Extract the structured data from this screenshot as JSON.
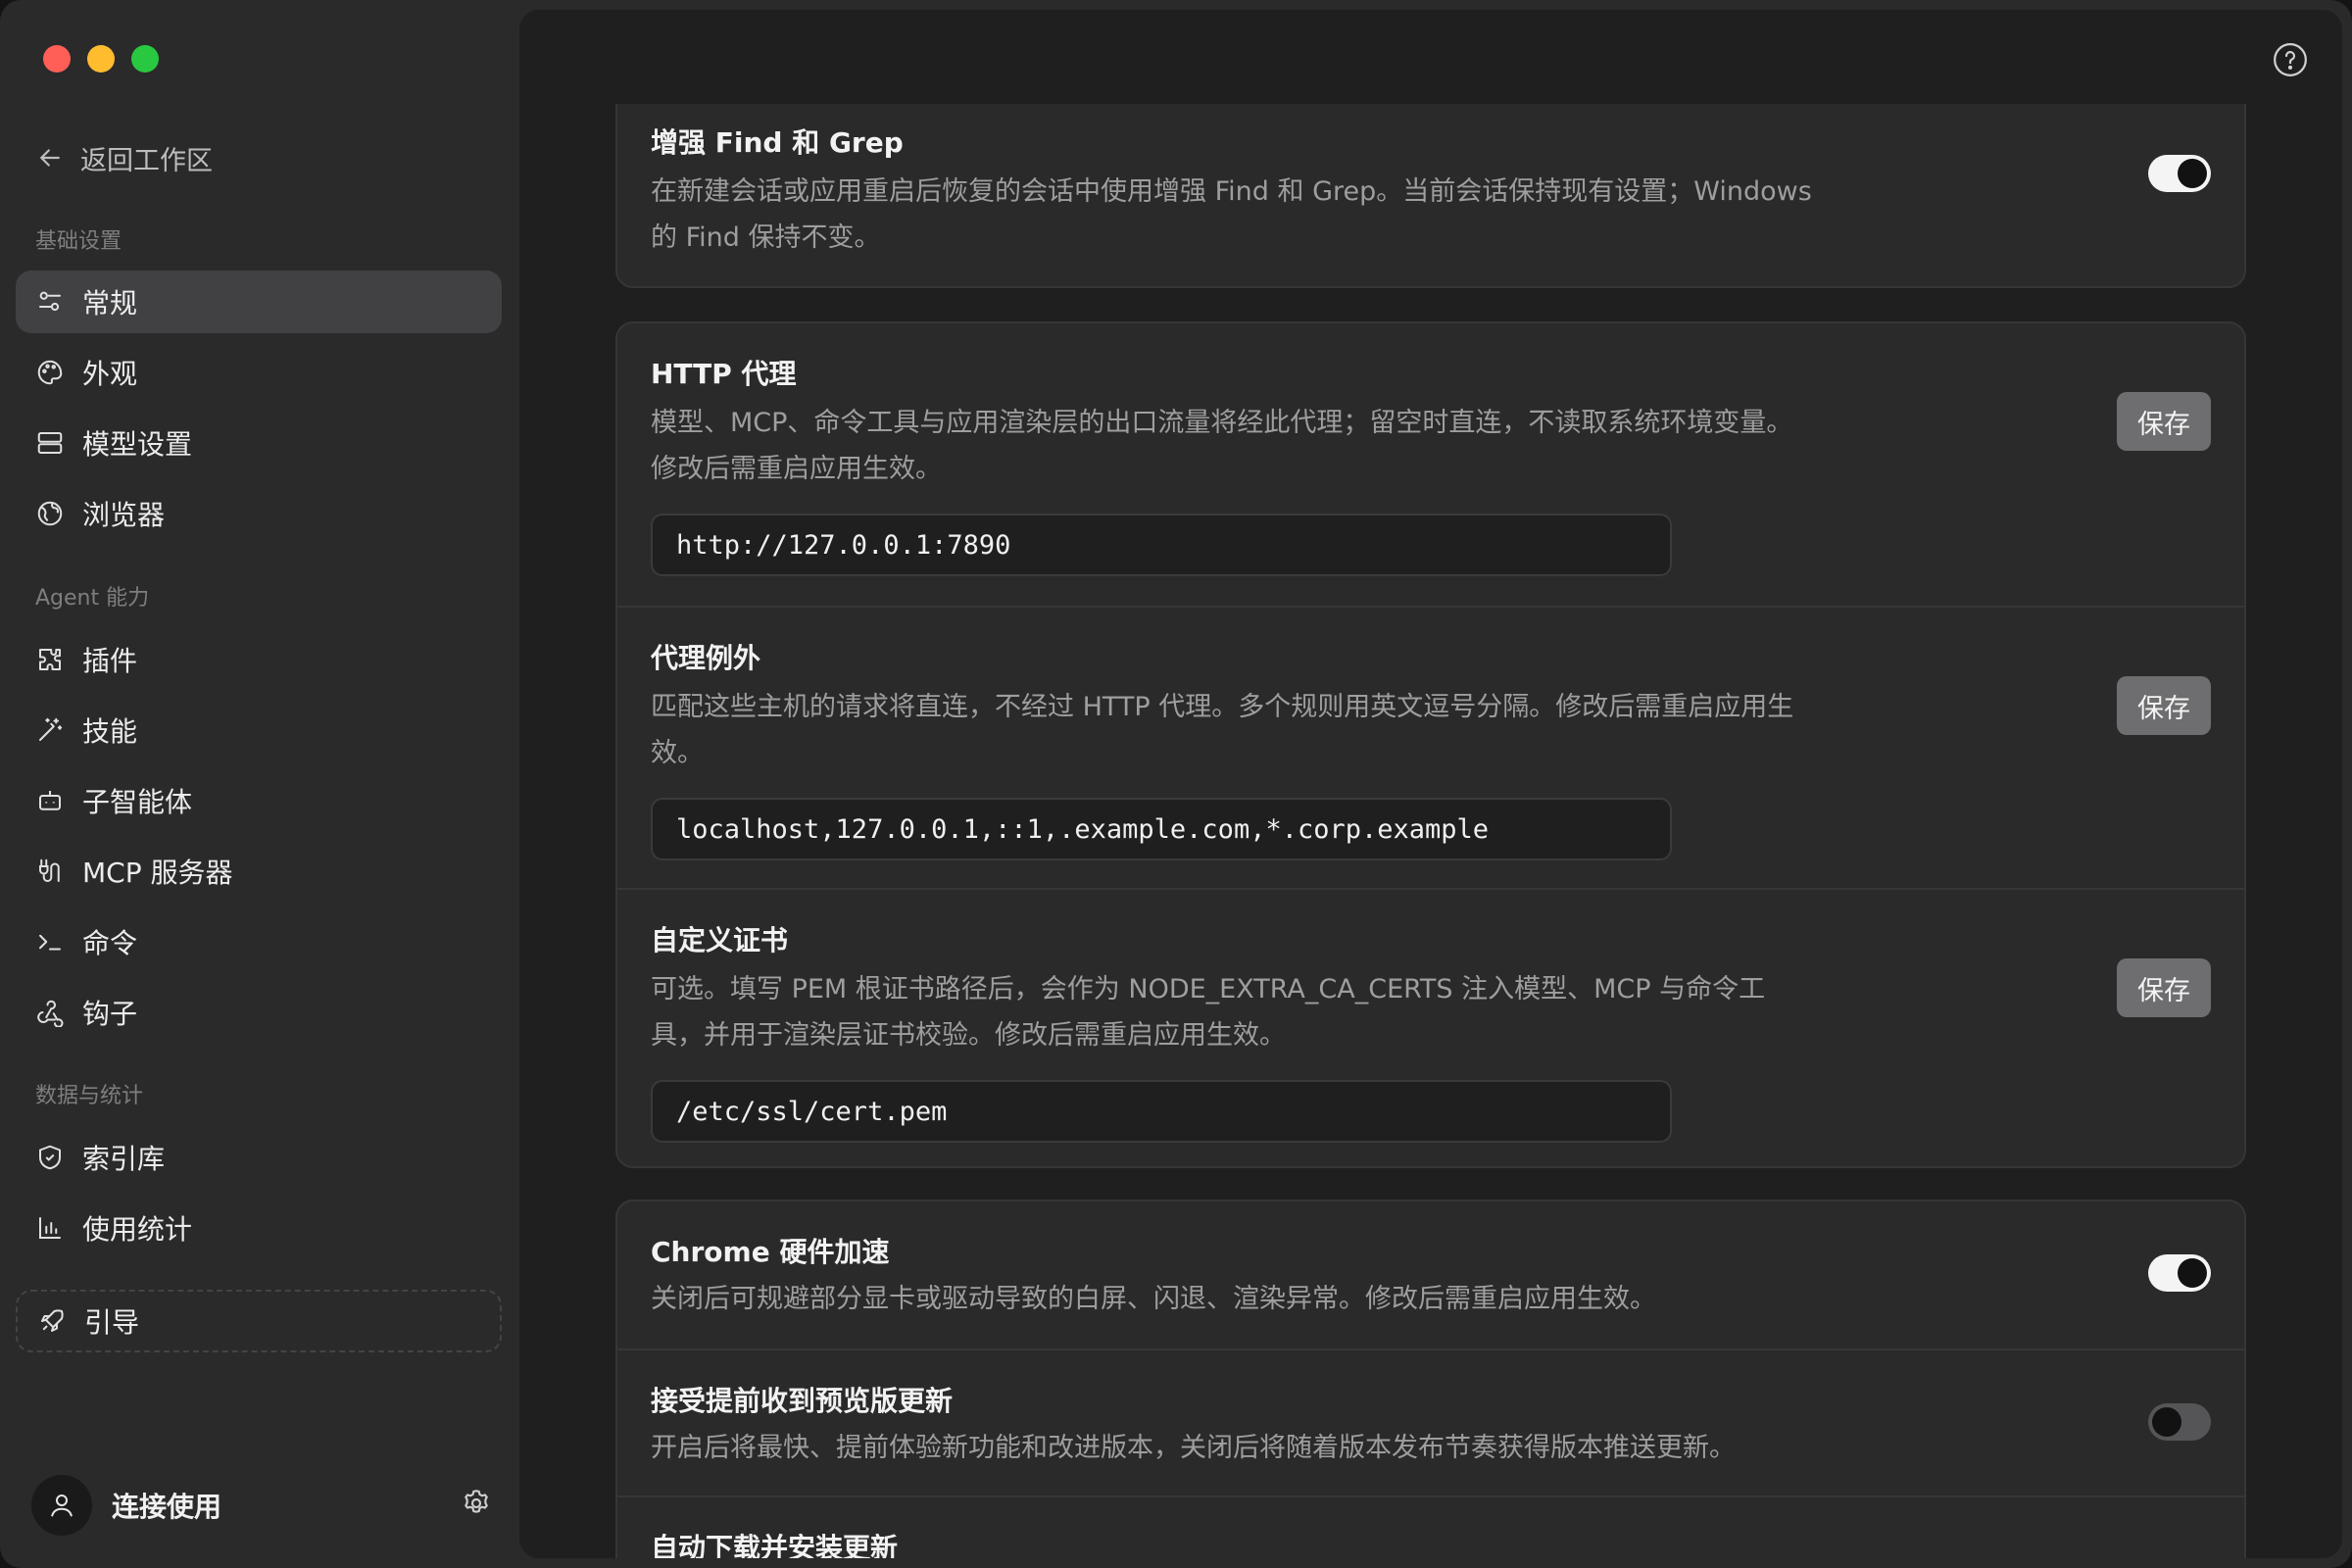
{
  "sidebar": {
    "back_label": "返回工作区",
    "sections": {
      "basic": "基础设置",
      "agent": "Agent 能力",
      "data": "数据与统计"
    },
    "items": {
      "general": "常规",
      "appearance": "外观",
      "model": "模型设置",
      "browser": "浏览器",
      "plugins": "插件",
      "skills": "技能",
      "subagent": "子智能体",
      "mcp": "MCP 服务器",
      "commands": "命令",
      "hooks": "钩子",
      "index": "索引库",
      "usage": "使用统计",
      "guide": "引导"
    },
    "active_item": "常规",
    "user_label": "连接使用"
  },
  "main": {
    "enhanced_grep": {
      "title": "增强 Find 和 Grep",
      "desc": "在新建会话或应用重启后恢复的会话中使用增强 Find 和 Grep。当前会话保持现有设置；Windows 的 Find 保持不变。",
      "enabled": true
    },
    "http_proxy": {
      "title": "HTTP 代理",
      "desc": "模型、MCP、命令工具与应用渲染层的出口流量将经此代理；留空时直连，不读取系统环境变量。修改后需重启应用生效。",
      "value": "http://127.0.0.1:7890",
      "save_label": "保存"
    },
    "proxy_bypass": {
      "title": "代理例外",
      "desc": "匹配这些主机的请求将直连，不经过 HTTP 代理。多个规则用英文逗号分隔。修改后需重启应用生效。",
      "value": "localhost,127.0.0.1,::1,.example.com,*.corp.example",
      "save_label": "保存"
    },
    "custom_cert": {
      "title": "自定义证书",
      "desc": "可选。填写 PEM 根证书路径后，会作为 NODE_EXTRA_CA_CERTS 注入模型、MCP 与命令工具，并用于渲染层证书校验。修改后需重启应用生效。",
      "value": "/etc/ssl/cert.pem",
      "save_label": "保存"
    },
    "chrome_hw": {
      "title": "Chrome 硬件加速",
      "desc": "关闭后可规避部分显卡或驱动导致的白屏、闪退、渲染异常。修改后需重启应用生效。",
      "enabled": true
    },
    "preview_updates": {
      "title": "接受提前收到预览版更新",
      "desc": "开启后将最快、提前体验新功能和改进版本，关闭后将随着版本发布节奏获得版本推送更新。",
      "enabled": false
    },
    "auto_update": {
      "title": "自动下载并安装更新"
    }
  },
  "colors": {
    "traffic_red": "#ff5f57",
    "traffic_yellow": "#febc2e",
    "traffic_green": "#28c840",
    "toggle_on": "#f4f4f4",
    "toggle_off": "#555557"
  }
}
